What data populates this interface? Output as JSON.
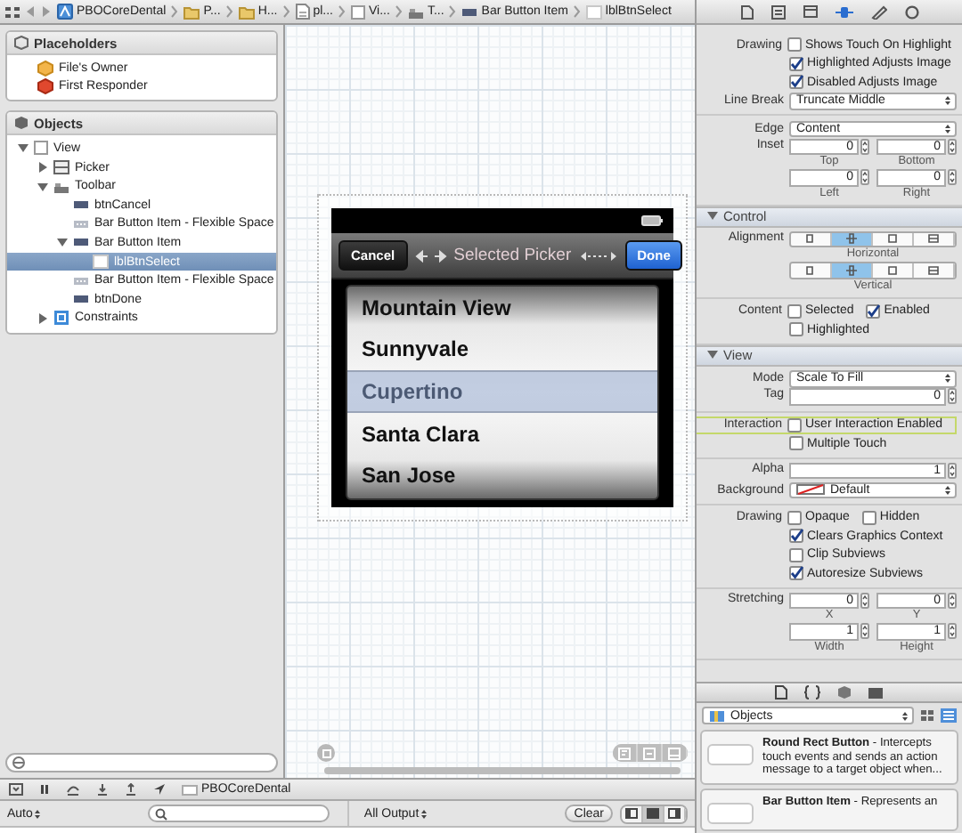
{
  "breadcrumbs": [
    {
      "label": "PBOCoreDental",
      "kind": "project"
    },
    {
      "label": "P...",
      "kind": "folder"
    },
    {
      "label": "H...",
      "kind": "folder"
    },
    {
      "label": "pl...",
      "kind": "file"
    },
    {
      "label": "Vi...",
      "kind": "view"
    },
    {
      "label": "T...",
      "kind": "toolbar"
    },
    {
      "label": "Bar Button Item",
      "kind": "bar-button"
    },
    {
      "label": "lblBtnSelect",
      "kind": "label"
    }
  ],
  "placeholders": {
    "title": "Placeholders",
    "items": [
      {
        "label": "File's Owner",
        "kind": "owner"
      },
      {
        "label": "First Responder",
        "kind": "responder"
      }
    ]
  },
  "objects": {
    "title": "Objects",
    "tree": [
      {
        "label": "View",
        "kind": "view",
        "expanded": true,
        "selected": false,
        "children": [
          {
            "label": "Picker",
            "kind": "picker",
            "expanded": false,
            "selected": false
          },
          {
            "label": "Toolbar",
            "kind": "toolbar",
            "expanded": true,
            "selected": false,
            "children": [
              {
                "label": "btnCancel",
                "kind": "bar-button",
                "selected": false
              },
              {
                "label": "Bar Button Item - Flexible Space",
                "kind": "flexible-space",
                "selected": false
              },
              {
                "label": "Bar Button Item",
                "kind": "bar-button",
                "expanded": true,
                "selected": false,
                "children": [
                  {
                    "label": "lblBtnSelect",
                    "kind": "label",
                    "selected": true
                  }
                ]
              },
              {
                "label": "Bar Button Item - Flexible Space",
                "kind": "flexible-space",
                "selected": false
              },
              {
                "label": "btnDone",
                "kind": "bar-button",
                "selected": false
              }
            ]
          },
          {
            "label": "Constraints",
            "kind": "constraints",
            "expanded": false,
            "selected": false
          }
        ]
      }
    ]
  },
  "phone": {
    "cancel": "Cancel",
    "title": "Selected Picker",
    "done": "Done",
    "picker": [
      {
        "label": "Mountain View",
        "selected": false
      },
      {
        "label": "Sunnyvale",
        "selected": false
      },
      {
        "label": "Cupertino",
        "selected": true
      },
      {
        "label": "Santa Clara",
        "selected": false
      },
      {
        "label": "San Jose",
        "selected": false
      }
    ]
  },
  "debug": {
    "scheme": "PBOCoreDental",
    "filter": "Auto",
    "output": "All Output",
    "clear": "Clear"
  },
  "inspector": {
    "sections": [
      {
        "groups": [
          [
            {
              "kind": "checks",
              "label": "Drawing",
              "outlined": false,
              "lines": [
                [
                  {
                    "label": "Shows Touch On Highlight",
                    "checked": false
                  }
                ],
                [
                  {
                    "label": "Highlighted Adjusts Image",
                    "checked": true
                  }
                ],
                [
                  {
                    "label": "Disabled Adjusts Image",
                    "checked": true
                  }
                ]
              ]
            },
            {
              "kind": "select",
              "label": "Line Break",
              "value": "Truncate Middle"
            }
          ],
          [
            {
              "kind": "select",
              "label": "Edge",
              "value": "Content"
            },
            {
              "kind": "steppers",
              "label": "Inset",
              "lines": [
                [
                  {
                    "value": "0",
                    "caption": "Top"
                  },
                  {
                    "value": "0",
                    "caption": "Bottom"
                  }
                ],
                [
                  {
                    "value": "0",
                    "caption": "Left"
                  },
                  {
                    "value": "0",
                    "caption": "Right"
                  }
                ]
              ]
            }
          ]
        ]
      },
      {
        "title": "Control",
        "groups": [
          [
            {
              "kind": "segments",
              "label": "Alignment",
              "caption": "Horizontal",
              "segments": [
                {
                  "selected": false
                },
                {
                  "selected": true
                },
                {
                  "selected": false
                },
                {
                  "selected": false
                }
              ]
            },
            {
              "kind": "segments",
              "caption": "Vertical",
              "segments": [
                {
                  "selected": false
                },
                {
                  "selected": true
                },
                {
                  "selected": false
                },
                {
                  "selected": false
                }
              ]
            }
          ],
          [
            {
              "kind": "checks",
              "label": "Content",
              "outlined": false,
              "lines": [
                [
                  {
                    "label": "Selected",
                    "checked": false
                  },
                  {
                    "label": "Enabled",
                    "checked": true
                  }
                ],
                [
                  {
                    "label": "Highlighted",
                    "checked": false
                  }
                ]
              ]
            }
          ]
        ]
      },
      {
        "title": "View",
        "groups": [
          [
            {
              "kind": "select",
              "label": "Mode",
              "value": "Scale To Fill"
            },
            {
              "kind": "steppers",
              "label": "Tag",
              "lines": [
                [
                  {
                    "value": "0"
                  }
                ]
              ]
            }
          ],
          [
            {
              "kind": "checks",
              "label": "Interaction",
              "outlined": true,
              "lines": [
                [
                  {
                    "label": "User Interaction Enabled",
                    "checked": false
                  }
                ],
                [
                  {
                    "label": "Multiple Touch",
                    "checked": false
                  }
                ]
              ]
            }
          ],
          [
            {
              "kind": "steppers",
              "label": "Alpha",
              "lines": [
                [
                  {
                    "value": "1"
                  }
                ]
              ]
            },
            {
              "kind": "color-select",
              "label": "Background",
              "value": "Default"
            }
          ],
          [
            {
              "kind": "checks",
              "label": "Drawing",
              "outlined": false,
              "lines": [
                [
                  {
                    "label": "Opaque",
                    "checked": false
                  },
                  {
                    "label": "Hidden",
                    "checked": false
                  }
                ],
                [
                  {
                    "label": "Clears Graphics Context",
                    "checked": true
                  }
                ],
                [
                  {
                    "label": "Clip Subviews",
                    "checked": false
                  }
                ],
                [
                  {
                    "label": "Autoresize Subviews",
                    "checked": true
                  }
                ]
              ]
            }
          ],
          [
            {
              "kind": "steppers",
              "label": "Stretching",
              "lines": [
                [
                  {
                    "value": "0",
                    "caption": "X"
                  },
                  {
                    "value": "0",
                    "caption": "Y"
                  }
                ],
                [
                  {
                    "value": "1",
                    "caption": "Width"
                  },
                  {
                    "value": "1",
                    "caption": "Height"
                  }
                ]
              ]
            }
          ]
        ]
      }
    ]
  },
  "library": {
    "filter": "Objects",
    "items": [
      {
        "text": "**Round Rect Button** - Intercepts touch events and sends an action message to a target object when..."
      },
      {
        "text": "**Bar Button Item** - Represents an"
      }
    ]
  }
}
